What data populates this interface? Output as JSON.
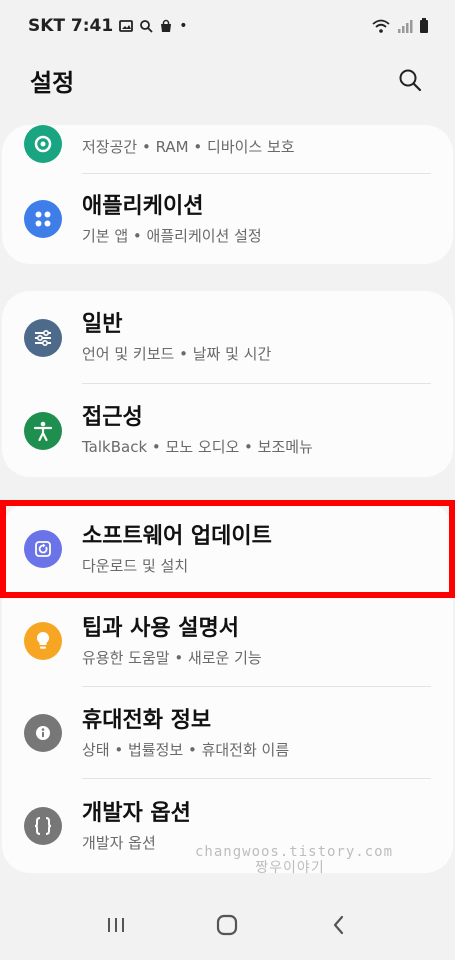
{
  "status": {
    "carrier_time": "SKT 7:41",
    "dot": "•"
  },
  "header": {
    "title": "설정"
  },
  "cards": [
    {
      "items": [
        {
          "title": "",
          "subtitle": "저장공간  •  RAM  •  디바이스 보호",
          "icon": "device-care-icon",
          "color": "#1aa582"
        },
        {
          "title": "애플리케이션",
          "subtitle": "기본 앱  •  애플리케이션 설정",
          "icon": "apps-icon",
          "color": "#3f7de8"
        }
      ]
    },
    {
      "items": [
        {
          "title": "일반",
          "subtitle": "언어 및 키보드  •  날짜 및 시간",
          "icon": "sliders-icon",
          "color": "#4e6a8a"
        },
        {
          "title": "접근성",
          "subtitle": "TalkBack  •  모노 오디오  •  보조메뉴",
          "icon": "accessibility-icon",
          "color": "#1e8f4e"
        }
      ]
    },
    {
      "items": [
        {
          "title": "소프트웨어 업데이트",
          "subtitle": "다운로드 및 설치",
          "icon": "software-update-icon",
          "color": "#6a74e8"
        },
        {
          "title": "팁과 사용 설명서",
          "subtitle": "유용한 도움말  •  새로운 기능",
          "icon": "lightbulb-icon",
          "color": "#f6a623"
        },
        {
          "title": "휴대전화 정보",
          "subtitle": "상태  •  법률정보  •  휴대전화 이름",
          "icon": "info-icon",
          "color": "#777777"
        },
        {
          "title": "개발자 옵션",
          "subtitle": "개발자 옵션",
          "icon": "developer-braces-icon",
          "color": "#777777"
        }
      ]
    }
  ],
  "watermark": {
    "line1": "changwoos.tistory.com",
    "line2": "짱우이야기"
  }
}
